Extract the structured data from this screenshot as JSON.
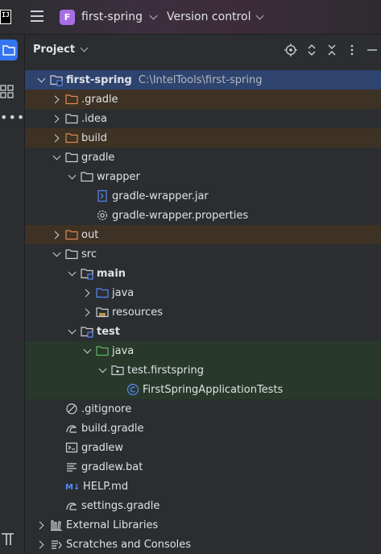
{
  "titlebar": {
    "app_icon_text": "IJ",
    "project_badge": "F",
    "project_name": "first-spring",
    "vcs_label": "Version control"
  },
  "panel": {
    "title": "Project"
  },
  "tree": [
    {
      "label": "first-spring",
      "path": "C:\\IntelTools\\first-spring",
      "depth": 0,
      "arrow": "down",
      "icon": "module-folder",
      "bold": true,
      "state": "sel"
    },
    {
      "label": ".gradle",
      "depth": 1,
      "arrow": "right",
      "icon": "folder-excluded",
      "state": "excl"
    },
    {
      "label": ".idea",
      "depth": 1,
      "arrow": "right",
      "icon": "folder"
    },
    {
      "label": "build",
      "depth": 1,
      "arrow": "right",
      "icon": "folder-excluded",
      "state": "excl"
    },
    {
      "label": "gradle",
      "depth": 1,
      "arrow": "down",
      "icon": "folder"
    },
    {
      "label": "wrapper",
      "depth": 2,
      "arrow": "down",
      "icon": "folder"
    },
    {
      "label": "gradle-wrapper.jar",
      "depth": 3,
      "arrow": "none",
      "icon": "jar"
    },
    {
      "label": "gradle-wrapper.properties",
      "depth": 3,
      "arrow": "none",
      "icon": "gear"
    },
    {
      "label": "out",
      "depth": 1,
      "arrow": "right",
      "icon": "folder-excluded",
      "state": "excl"
    },
    {
      "label": "src",
      "depth": 1,
      "arrow": "down",
      "icon": "folder"
    },
    {
      "label": "main",
      "depth": 2,
      "arrow": "down",
      "icon": "module-folder",
      "bold": true
    },
    {
      "label": "java",
      "depth": 3,
      "arrow": "right",
      "icon": "folder-source"
    },
    {
      "label": "resources",
      "depth": 3,
      "arrow": "right",
      "icon": "folder-resources"
    },
    {
      "label": "test",
      "depth": 2,
      "arrow": "down",
      "icon": "module-folder",
      "bold": true
    },
    {
      "label": "java",
      "depth": 3,
      "arrow": "down",
      "icon": "folder-test",
      "state": "tst"
    },
    {
      "label": "test.firstspring",
      "depth": 4,
      "arrow": "down",
      "icon": "package",
      "state": "tst"
    },
    {
      "label": "FirstSpringApplicationTests",
      "depth": 5,
      "arrow": "none",
      "icon": "class",
      "state": "tst"
    },
    {
      "label": ".gitignore",
      "depth": 1,
      "arrow": "none",
      "icon": "ignore"
    },
    {
      "label": "build.gradle",
      "depth": 1,
      "arrow": "none",
      "icon": "gradle"
    },
    {
      "label": "gradlew",
      "depth": 1,
      "arrow": "none",
      "icon": "terminal"
    },
    {
      "label": "gradlew.bat",
      "depth": 1,
      "arrow": "none",
      "icon": "text-lines"
    },
    {
      "label": "HELP.md",
      "depth": 1,
      "arrow": "none",
      "icon": "markdown"
    },
    {
      "label": "settings.gradle",
      "depth": 1,
      "arrow": "none",
      "icon": "gradle"
    },
    {
      "label": "External Libraries",
      "depth": 0,
      "arrow": "right",
      "icon": "libraries"
    },
    {
      "label": "Scratches and Consoles",
      "depth": 0,
      "arrow": "right",
      "icon": "scratches"
    }
  ],
  "colors": {
    "accent": "#3574f0",
    "selection": "#2e436e",
    "excluded_row": "#3d3223",
    "test_row": "#28382a",
    "excluded_folder": "#e08855",
    "source_folder": "#548af7",
    "test_folder": "#5fb865",
    "project_badge": "#a86ee6"
  }
}
